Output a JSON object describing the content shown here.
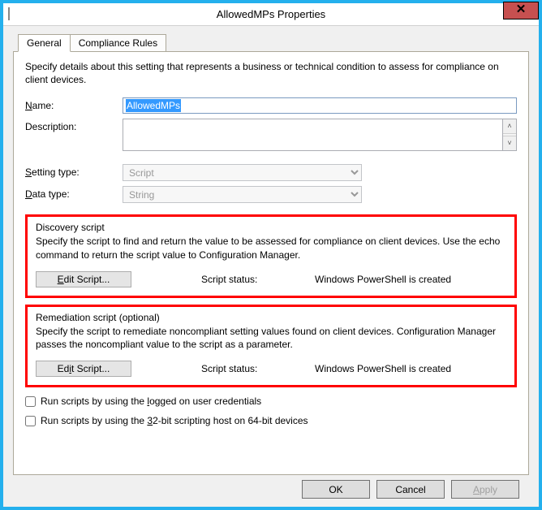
{
  "window": {
    "title": "AllowedMPs Properties",
    "close_label": "✕"
  },
  "tabs": {
    "general": "General",
    "compliance": "Compliance Rules"
  },
  "intro": "Specify details about this setting that represents a business or technical condition to assess for compliance on client devices.",
  "labels": {
    "name": "Name:",
    "name_u": "N",
    "description": "Description:",
    "setting_type": "Setting type:",
    "setting_type_u": "S",
    "data_type": "Data type:",
    "data_type_u": "D"
  },
  "values": {
    "name": "AllowedMPs",
    "description": "",
    "setting_type": "Script",
    "data_type": "String"
  },
  "discovery": {
    "title": "Discovery script",
    "desc": "Specify the script to find and return the value to be assessed for compliance on client devices. Use the echo command to return the script value to Configuration Manager.",
    "edit_label": "Edit Script...",
    "edit_u": "E",
    "status_label": "Script status:",
    "status_value": "Windows PowerShell is created"
  },
  "remediation": {
    "title": "Remediation script (optional)",
    "desc": "Specify the script to remediate noncompliant setting values found on client devices. Configuration Manager passes the noncompliant value to the script as a parameter.",
    "edit_label": "Edit Script...",
    "edit_u": "i",
    "status_label": "Script status:",
    "status_value": "Windows PowerShell is created"
  },
  "checks": {
    "logged_on": "Run scripts by using the logged on user credentials",
    "logged_on_u": "l",
    "bit32": "Run scripts by using the 32-bit scripting host on 64-bit devices",
    "bit32_u": "3"
  },
  "buttons": {
    "ok": "OK",
    "cancel": "Cancel",
    "apply": "Apply",
    "apply_u": "A"
  }
}
